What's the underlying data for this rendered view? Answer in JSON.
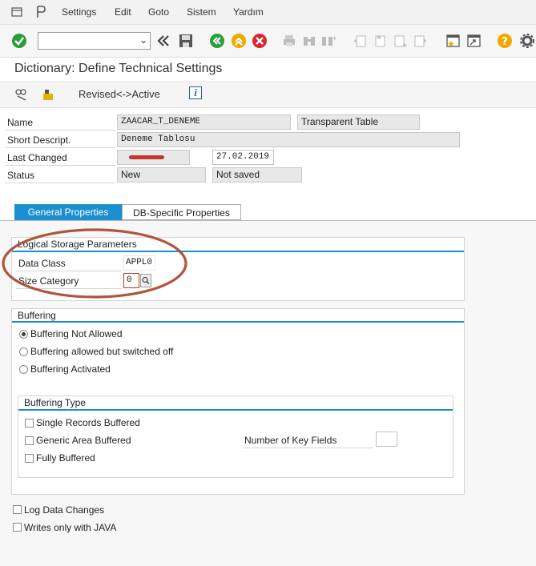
{
  "menu": {
    "items": [
      "Settings",
      "Edit",
      "Goto",
      "Sistem",
      "Yardım"
    ]
  },
  "toolbar": {
    "command_field_value": ""
  },
  "header": {
    "title": "Dictionary: Define Technical Settings"
  },
  "app_toolbar": {
    "revised_active_label": "Revised<->Active",
    "info_label": "i"
  },
  "fields": {
    "name_label": "Name",
    "name_value": "ZAACAR_T_DENEME",
    "name_type": "Transparent Table",
    "short_descript_label": "Short Descript.",
    "short_descript_value": "Deneme Tablosu",
    "last_changed_label": "Last Changed",
    "last_changed_date": "27.02.2019",
    "status_label": "Status",
    "status_value": "New",
    "status_save": "Not saved"
  },
  "tabs": [
    {
      "label": "General Properties",
      "active": true
    },
    {
      "label": "DB-Specific Properties",
      "active": false
    }
  ],
  "logical_storage": {
    "title": "Logical Storage Parameters",
    "data_class_label": "Data Class",
    "data_class_value": "APPL0",
    "size_category_label": "Size Category",
    "size_category_value": "0"
  },
  "buffering": {
    "title": "Buffering",
    "options": [
      {
        "label": "Buffering Not Allowed",
        "selected": true
      },
      {
        "label": "Buffering allowed but switched off",
        "selected": false
      },
      {
        "label": "Buffering Activated",
        "selected": false
      }
    ]
  },
  "buffering_type": {
    "title": "Buffering Type",
    "options": [
      {
        "label": "Single Records Buffered",
        "checked": false
      },
      {
        "label": "Generic Area Buffered",
        "checked": false
      },
      {
        "label": "Fully Buffered",
        "checked": false
      }
    ],
    "key_fields_label": "Number of Key Fields",
    "key_fields_value": ""
  },
  "options": {
    "log_data_changes": "Log Data Changes",
    "writes_only_java": "Writes only with JAVA"
  },
  "colors": {
    "accent": "#1a8fd1",
    "annotation": "#b04a2e",
    "redacted": "#c0392b"
  }
}
